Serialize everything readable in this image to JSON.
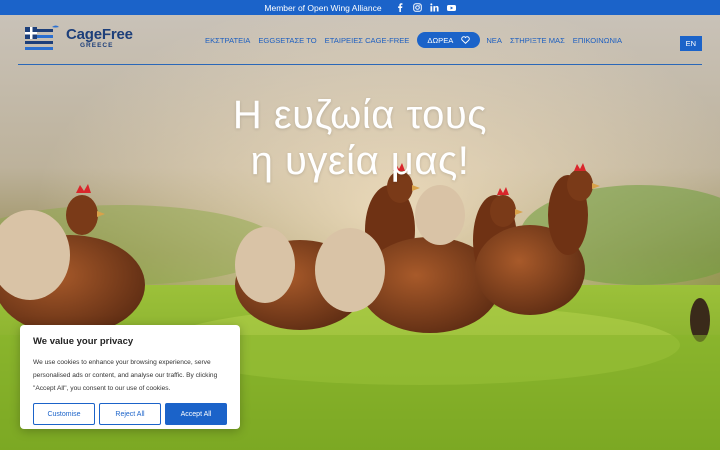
{
  "topbar": {
    "text": "Member of Open Wing Alliance",
    "social_icons": [
      "facebook-icon",
      "instagram-icon",
      "linkedin-icon",
      "youtube-icon"
    ]
  },
  "logo": {
    "line1": "CageFree",
    "line2": "GREECE"
  },
  "nav": {
    "items": [
      "ΕΚΣΤΡΑΤΕΙΑ",
      "EGGSETAΣΕ ΤΟ",
      "ΕΤΑΙΡΕΙΕΣ CAGE-FREE"
    ],
    "donate": "ΔΩΡΕΑ",
    "items_after": [
      "ΝΕΑ",
      "ΣΤΗΡΙΞΤΕ ΜΑΣ",
      "ΕΠΙΚΟΙΝΩΝΙΑ"
    ],
    "language": "EN"
  },
  "hero": {
    "line1": "Η ευζωία τους",
    "line2": "η υγεία μας!"
  },
  "cookie": {
    "title": "We value your privacy",
    "text": "We use cookies to enhance your browsing experience, serve personalised ads or content, and analyse our traffic. By clicking \"Accept All\", you consent to our use of cookies.",
    "customise": "Customise",
    "reject": "Reject All",
    "accept": "Accept All"
  },
  "colors": {
    "brand_blue": "#1b63c9",
    "logo_navy": "#1d3f7a"
  }
}
